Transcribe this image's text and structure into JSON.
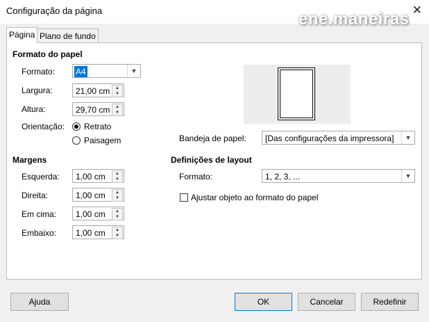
{
  "window": {
    "title": "Configuração da página",
    "watermark": "ene.maneiras"
  },
  "tabs": [
    {
      "label": "Página",
      "active": true
    },
    {
      "label": "Plano de fundo",
      "active": false
    }
  ],
  "paper_format": {
    "heading": "Formato do papel",
    "format_label": "Formato:",
    "format_value": "A4",
    "width_label": "Largura:",
    "width_value": "21,00 cm",
    "height_label": "Altura:",
    "height_value": "29,70 cm",
    "orientation_label": "Orientação:",
    "portrait_label": "Retrato",
    "landscape_label": "Paisagem",
    "orientation_selected": "Retrato"
  },
  "paper_tray": {
    "label": "Bandeja de papel:",
    "value": "[Das configurações da impressora]"
  },
  "margins": {
    "heading": "Margens",
    "left_label": "Esquerda:",
    "left_value": "1,00 cm",
    "right_label": "Direita:",
    "right_value": "1,00 cm",
    "top_label": "Em cima:",
    "top_value": "1,00 cm",
    "bottom_label": "Embaixo:",
    "bottom_value": "1,00 cm"
  },
  "layout": {
    "heading": "Definições de layout",
    "format_label": "Formato:",
    "format_value": "1, 2, 3, ...",
    "fit_label": "Ajustar objeto ao formato do papel",
    "fit_checked": false
  },
  "buttons": {
    "help": "Ajuda",
    "ok": "OK",
    "cancel": "Cancelar",
    "reset": "Redefinir"
  },
  "colors": {
    "accent": "#0078d7",
    "dialog_bg": "#f0f0f0",
    "panel_bg": "#ffffff"
  }
}
